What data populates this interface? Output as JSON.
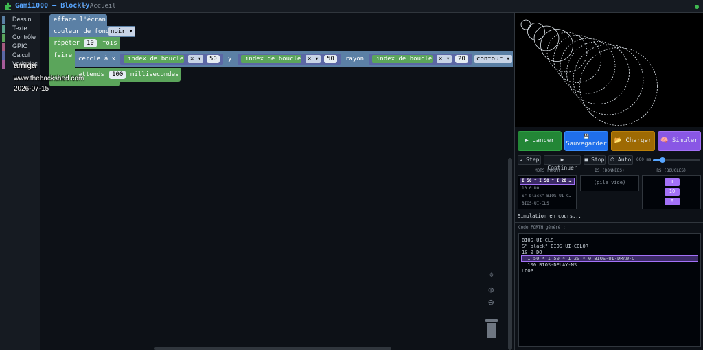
{
  "header": {
    "title": "Gami1000 — Blockly",
    "breadcrumb": "← Accueil"
  },
  "toolbox": {
    "items": [
      {
        "label": "Dessin",
        "color": "#5b80a5"
      },
      {
        "label": "Texte",
        "color": "#5ba58c"
      },
      {
        "label": "Contrôle",
        "color": "#5ba55b"
      },
      {
        "label": "GPIO",
        "color": "#a55b80"
      },
      {
        "label": "Calcul",
        "color": "#5b67a5"
      },
      {
        "label": "Variables",
        "color": "#a55b99"
      }
    ]
  },
  "overlay": {
    "line1": "amiga",
    "line2": "www.thebackshed.com",
    "line3": "2026-07-15"
  },
  "blocks": {
    "clear": "efface l'écran",
    "bgcolor_label": "couleur de fond",
    "bgcolor_value": "noir ▾",
    "repeat_label": "répéter",
    "repeat_count": "10",
    "repeat_unit": "fois",
    "do_label": "faire",
    "circle_label": "cercle à x",
    "loop_index": "index de boucle",
    "times_op": "× ▾",
    "x_factor": "50",
    "y_label": "y",
    "y_factor": "50",
    "radius_label": "rayon",
    "radius_factor": "20",
    "mode": "contour ▾",
    "wait_label": "attends",
    "wait_value": "100",
    "wait_unit": "millisecondes"
  },
  "actions": {
    "run": "▶ Lancer",
    "save_icon": "💾",
    "save": "Sauvegarder",
    "load": "📂 Charger",
    "simulate": "🧠 Simuler"
  },
  "sim": {
    "step": "↳ Step",
    "continue": "▶ Continuer",
    "stop": "■ Stop",
    "auto": "⏱ Auto",
    "speed": "600 ms",
    "speed_fraction": 0.2,
    "words_header": "MOTS FORTH",
    "ds_header": "DS (DONNÉES)",
    "rs_header": "RS (BOUCLES)",
    "words": [
      "I 50 * I 50 * I 20 …",
      "10 0 DO",
      "S\" black\" BIOS-UI-C…",
      "BIOS-UI-CLS"
    ],
    "ds_empty": "(pile vide)",
    "rs_values": [
      "1",
      "10",
      "0"
    ],
    "status": "Simulation en cours..."
  },
  "code": {
    "label": "Code FORTH généré :",
    "lines": [
      "BIOS-UI-CLS",
      "S\" black\" BIOS-UI-COLOR",
      "10 0 DO",
      "  I 50 * I 50 * I 20 * 0 BIOS-UI-DRAW-C",
      "  100 BIOS-DELAY-MS",
      "LOOP"
    ]
  },
  "colors": {
    "accent": "#58a6ff",
    "draw_block": "#5b80a5",
    "control_block": "#5ba55b",
    "calc_block": "#5b67a5",
    "highlight": "#a371f7",
    "run_btn": "#238636",
    "save_btn": "#1f6feb",
    "load_btn": "#9e6a03",
    "sim_btn": "#8957e5"
  }
}
